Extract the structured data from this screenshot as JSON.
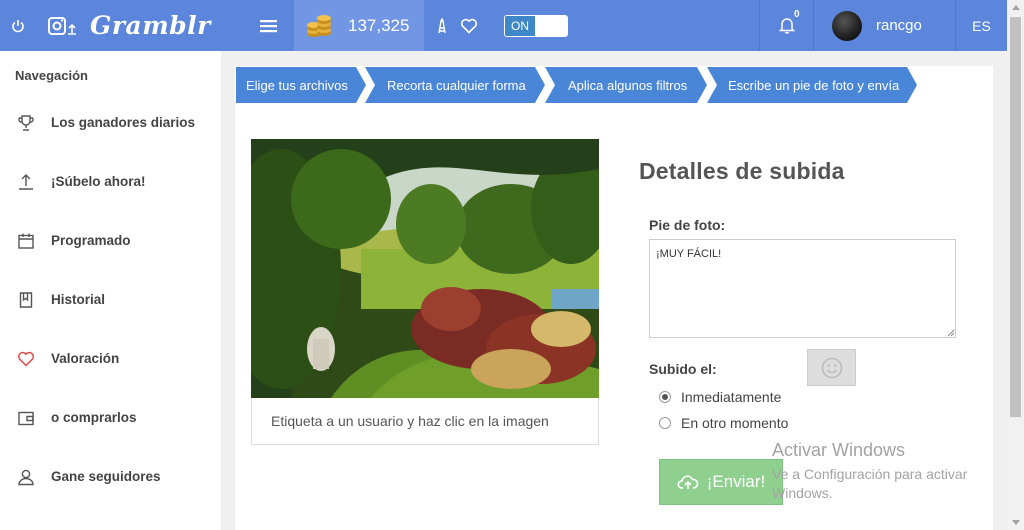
{
  "topbar": {
    "logo_text": "Gramblr",
    "coins": "137,325",
    "toggle_label": "ON",
    "notification_count": "0",
    "username": "rancgo",
    "language": "ES"
  },
  "sidebar": {
    "title": "Navegación",
    "items": [
      {
        "label": "Los ganadores diarios",
        "icon": "trophy-icon"
      },
      {
        "label": "¡Súbelo ahora!",
        "icon": "upload-icon"
      },
      {
        "label": "Programado",
        "icon": "calendar-icon"
      },
      {
        "label": "Historial",
        "icon": "history-icon"
      },
      {
        "label": "Valoración",
        "icon": "heart-icon"
      },
      {
        "label": "o comprarlos",
        "icon": "wallet-icon"
      },
      {
        "label": "Gane seguidores",
        "icon": "user-icon"
      }
    ]
  },
  "steps": [
    "Elige tus archivos",
    "Recorta cualquier forma",
    "Aplica algunos filtros",
    "Escribe un pie de foto y envía"
  ],
  "photo": {
    "tag_hint": "Etiqueta a un usuario y haz clic en la imagen"
  },
  "details": {
    "title": "Detalles de subida",
    "caption_label": "Pie de foto:",
    "caption_value": "¡MUY FÁCIL!",
    "uploaded_label": "Subido el:",
    "options": [
      "Inmediatamente",
      "En otro momento"
    ],
    "selected_option": "Inmediatamente",
    "send_label": "¡Enviar!"
  },
  "watermark": {
    "line1": "Activar Windows",
    "line2": "Ve a Configuración para activar Windows."
  },
  "colors": {
    "topbar": "#5b86dc",
    "step": "#4a86d8",
    "send_button": "#8fd08f",
    "heart": "#e04848"
  }
}
